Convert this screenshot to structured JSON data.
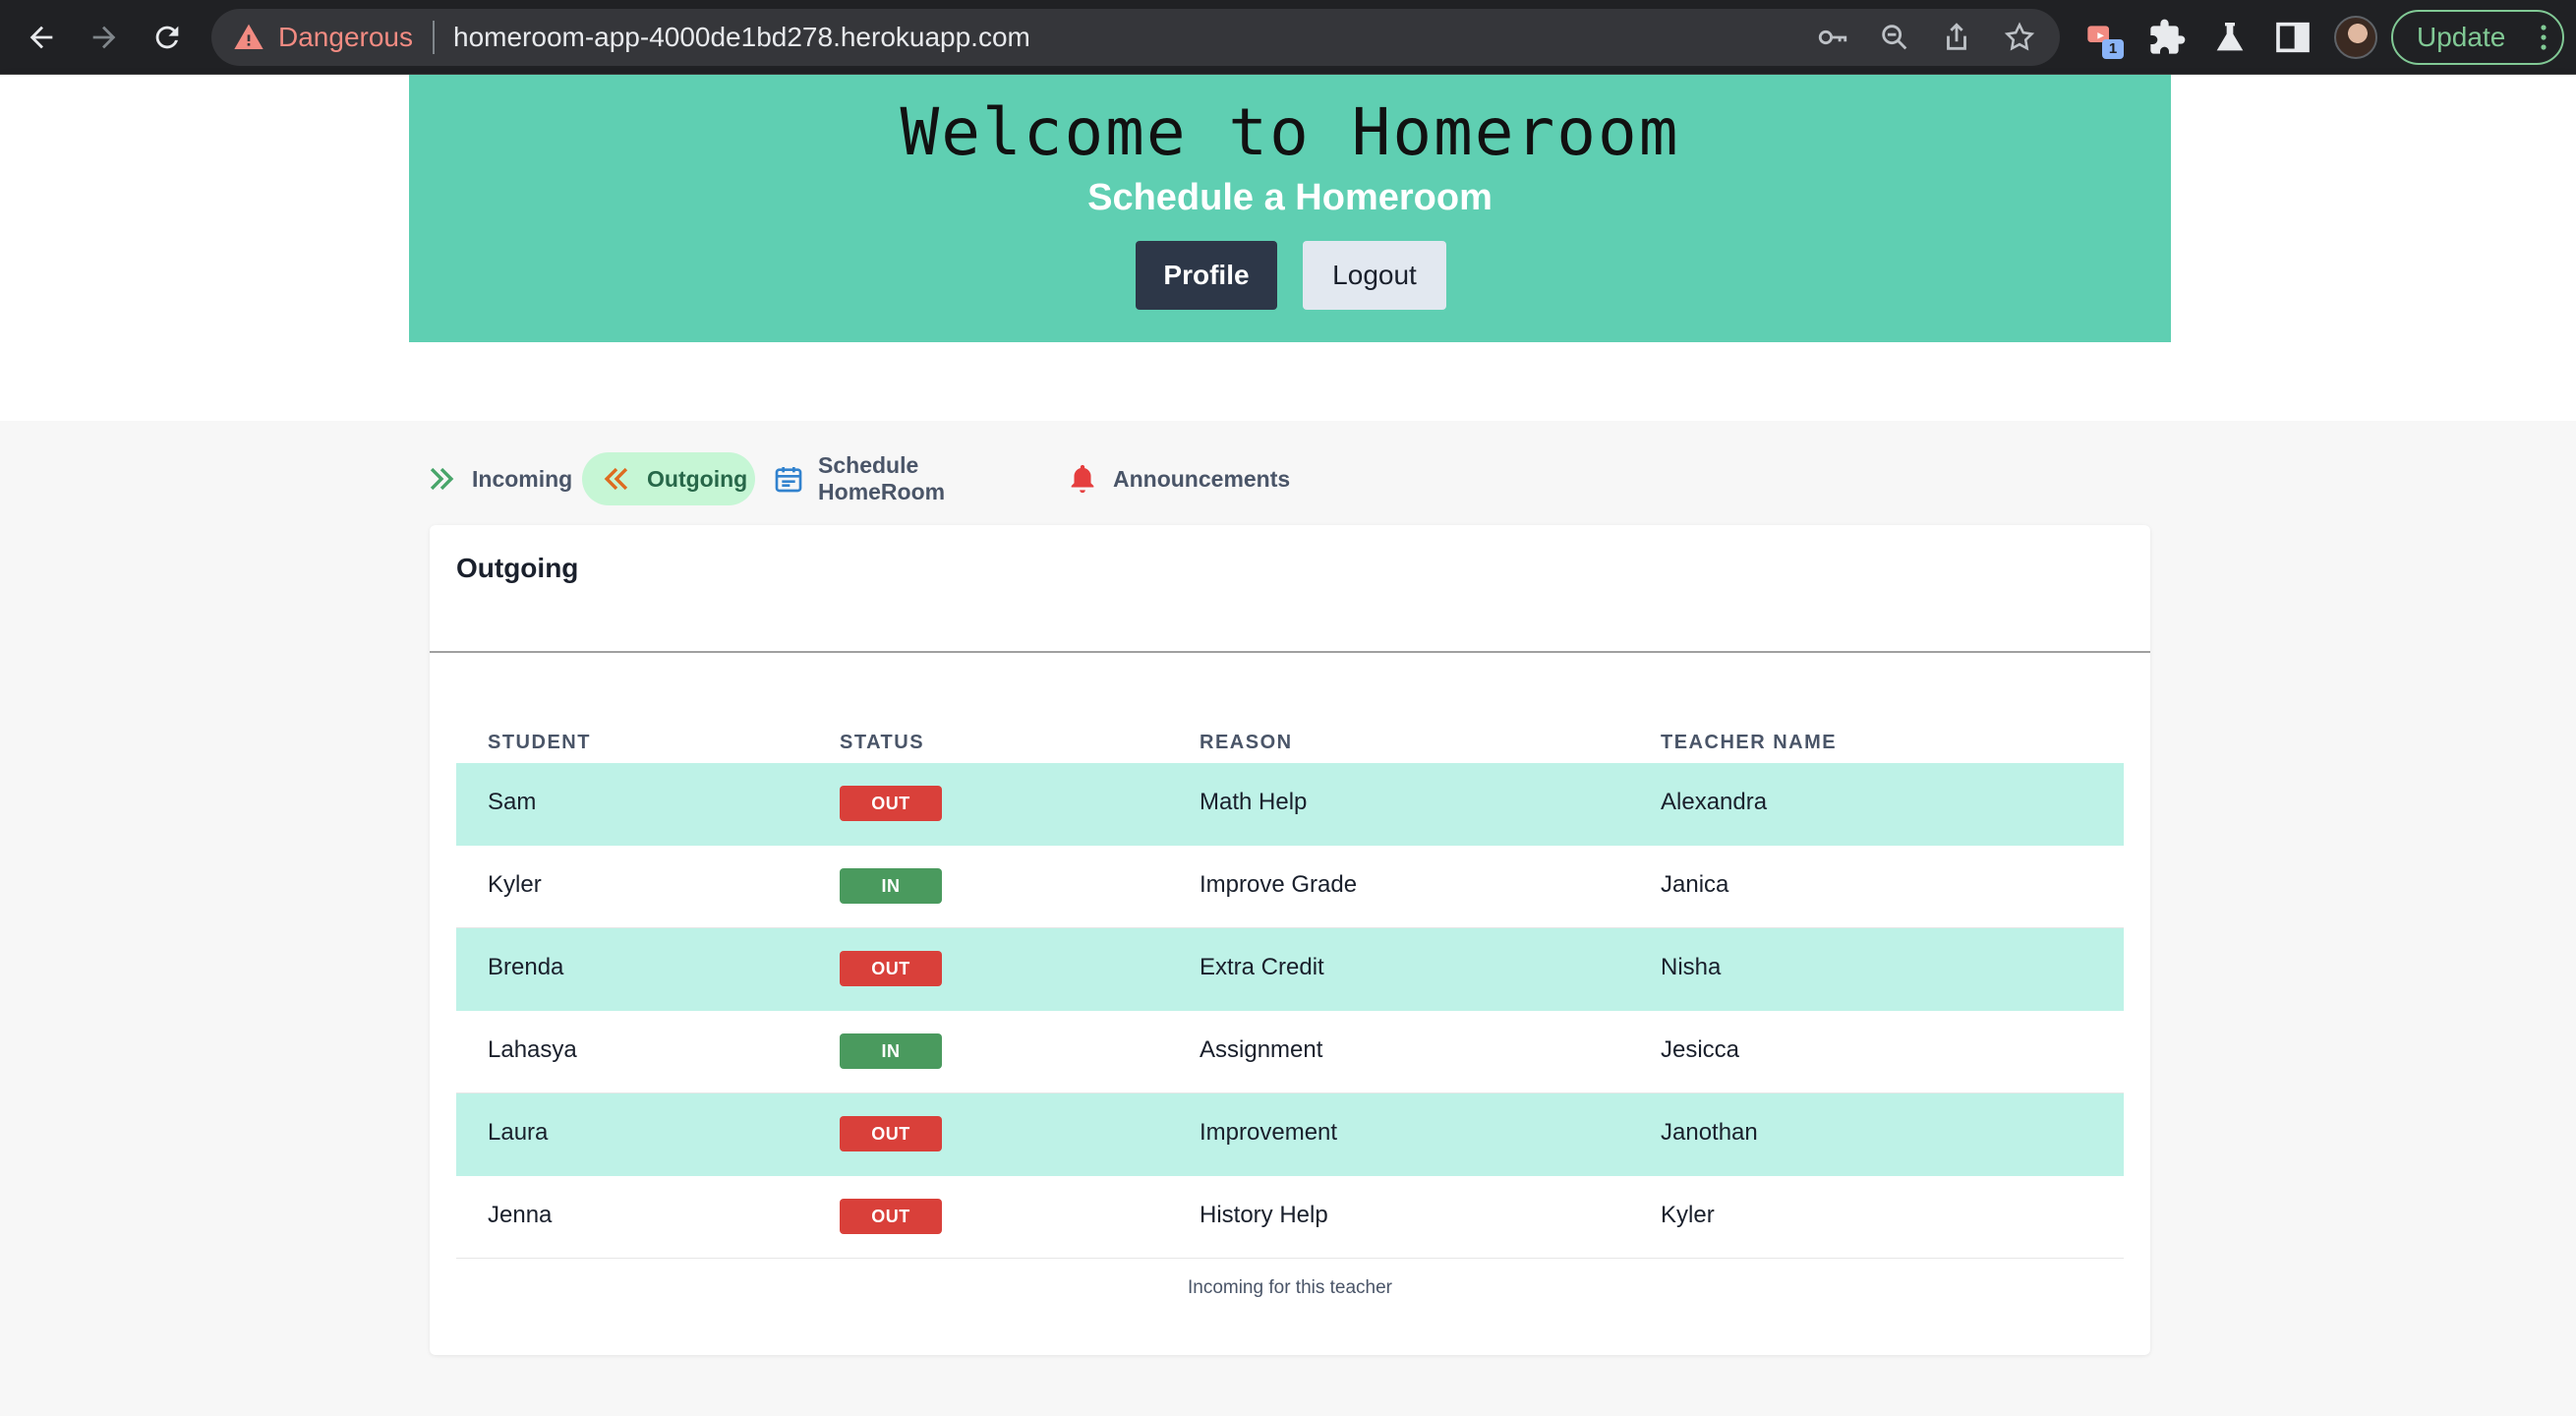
{
  "browser": {
    "security_label": "Dangerous",
    "url": "homeroom-app-4000de1bd278.herokuapp.com",
    "extension_badge": "1",
    "update_label": "Update"
  },
  "hero": {
    "title": "Welcome to Homeroom",
    "subtitle": "Schedule a Homeroom",
    "profile_label": "Profile",
    "logout_label": "Logout"
  },
  "tabs": [
    {
      "label": "Incoming",
      "icon": "double-chevron-right-icon",
      "active": false
    },
    {
      "label": "Outgoing",
      "icon": "double-chevron-left-icon",
      "active": true
    },
    {
      "label": "Schedule HomeRoom",
      "icon": "calendar-icon",
      "active": false
    },
    {
      "label": "Announcements",
      "icon": "bell-icon",
      "active": false
    }
  ],
  "card": {
    "title": "Outgoing",
    "columns": [
      "STUDENT",
      "STATUS",
      "REASON",
      "TEACHER NAME"
    ],
    "rows": [
      {
        "student": "Sam",
        "status": "OUT",
        "reason": "Math Help",
        "teacher": "Alexandra"
      },
      {
        "student": "Kyler",
        "status": "IN",
        "reason": "Improve Grade",
        "teacher": "Janica"
      },
      {
        "student": "Brenda",
        "status": "OUT",
        "reason": "Extra Credit",
        "teacher": "Nisha"
      },
      {
        "student": "Lahasya",
        "status": "IN",
        "reason": "Assignment",
        "teacher": "Jesicca"
      },
      {
        "student": "Laura",
        "status": "OUT",
        "reason": "Improvement",
        "teacher": "Janothan"
      },
      {
        "student": "Jenna",
        "status": "OUT",
        "reason": "History Help",
        "teacher": "Kyler"
      }
    ],
    "caption": "Incoming for this teacher"
  },
  "colors": {
    "hero_bg": "#5fcfb2",
    "row_stripe": "#bef2e7",
    "badge_out": "#d9403a",
    "badge_in": "#4a9a5e",
    "active_tab_bg": "#c6f6d5"
  }
}
